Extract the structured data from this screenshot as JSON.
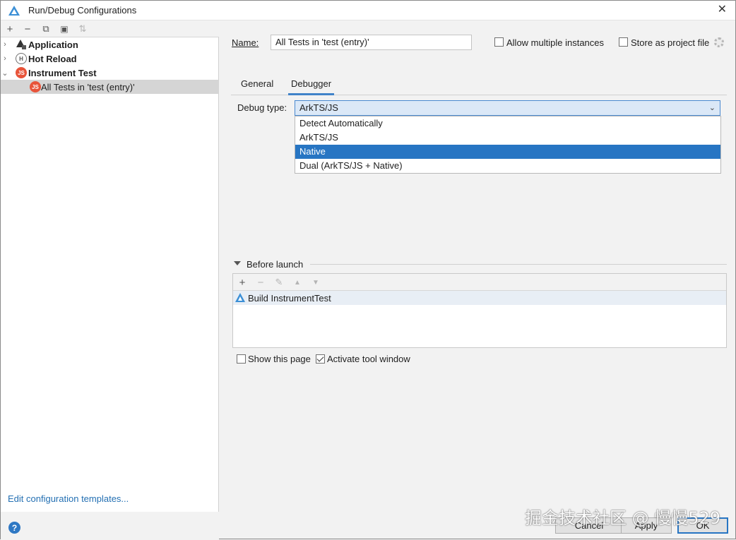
{
  "window": {
    "title": "Run/Debug Configurations",
    "close_glyph": "✕",
    "accent_color": "#2775c3"
  },
  "left_toolbar": {
    "add_glyph": "+",
    "remove_glyph": "−",
    "copy_glyph": "⧉",
    "folder_glyph": "▣",
    "sort_glyph": "⇅"
  },
  "tree": {
    "items": [
      {
        "label": "Application",
        "expanded": false,
        "icon": "application-icon"
      },
      {
        "label": "Hot Reload",
        "expanded": false,
        "icon": "hot-reload-icon",
        "icon_text": "H"
      },
      {
        "label": "Instrument Test",
        "expanded": true,
        "icon": "js-icon",
        "icon_text": "JS"
      },
      {
        "label": "All Tests in 'test (entry)'",
        "selected": true,
        "icon": "js-icon",
        "icon_text": "JS"
      }
    ],
    "arrow_collapsed": "›",
    "arrow_expanded": "⌄"
  },
  "edit_templates": "Edit configuration templates...",
  "help_glyph": "?",
  "config": {
    "name_label": "Name:",
    "name_value": "All Tests in 'test (entry)'",
    "allow_multiple": {
      "label": "Allow multiple instances",
      "checked": false
    },
    "store_as_project": {
      "label": "Store as project file",
      "checked": false
    }
  },
  "tabs": [
    {
      "label": "General",
      "active": false
    },
    {
      "label": "Debugger",
      "active": true
    }
  ],
  "debug_type": {
    "label": "Debug type:",
    "value": "ArkTS/JS",
    "options": [
      {
        "label": "Detect Automatically",
        "selected": false
      },
      {
        "label": "ArkTS/JS",
        "selected": false
      },
      {
        "label": "Native",
        "selected": true
      },
      {
        "label": "Dual (ArkTS/JS + Native)",
        "selected": false
      }
    ]
  },
  "before_launch": {
    "title": "Before launch",
    "items": [
      "Build InstrumentTest"
    ],
    "toolbar": {
      "add": "+",
      "remove": "−",
      "edit": "✎",
      "up": "▲",
      "down": "▼"
    }
  },
  "show_page": {
    "label": "Show this page",
    "checked": false
  },
  "activate_tool_window": {
    "label": "Activate tool window",
    "checked": true
  },
  "buttons": {
    "cancel": "Cancel",
    "apply": "Apply",
    "ok": "OK"
  },
  "watermark": "掘金技术社区 @ 慢慢529"
}
